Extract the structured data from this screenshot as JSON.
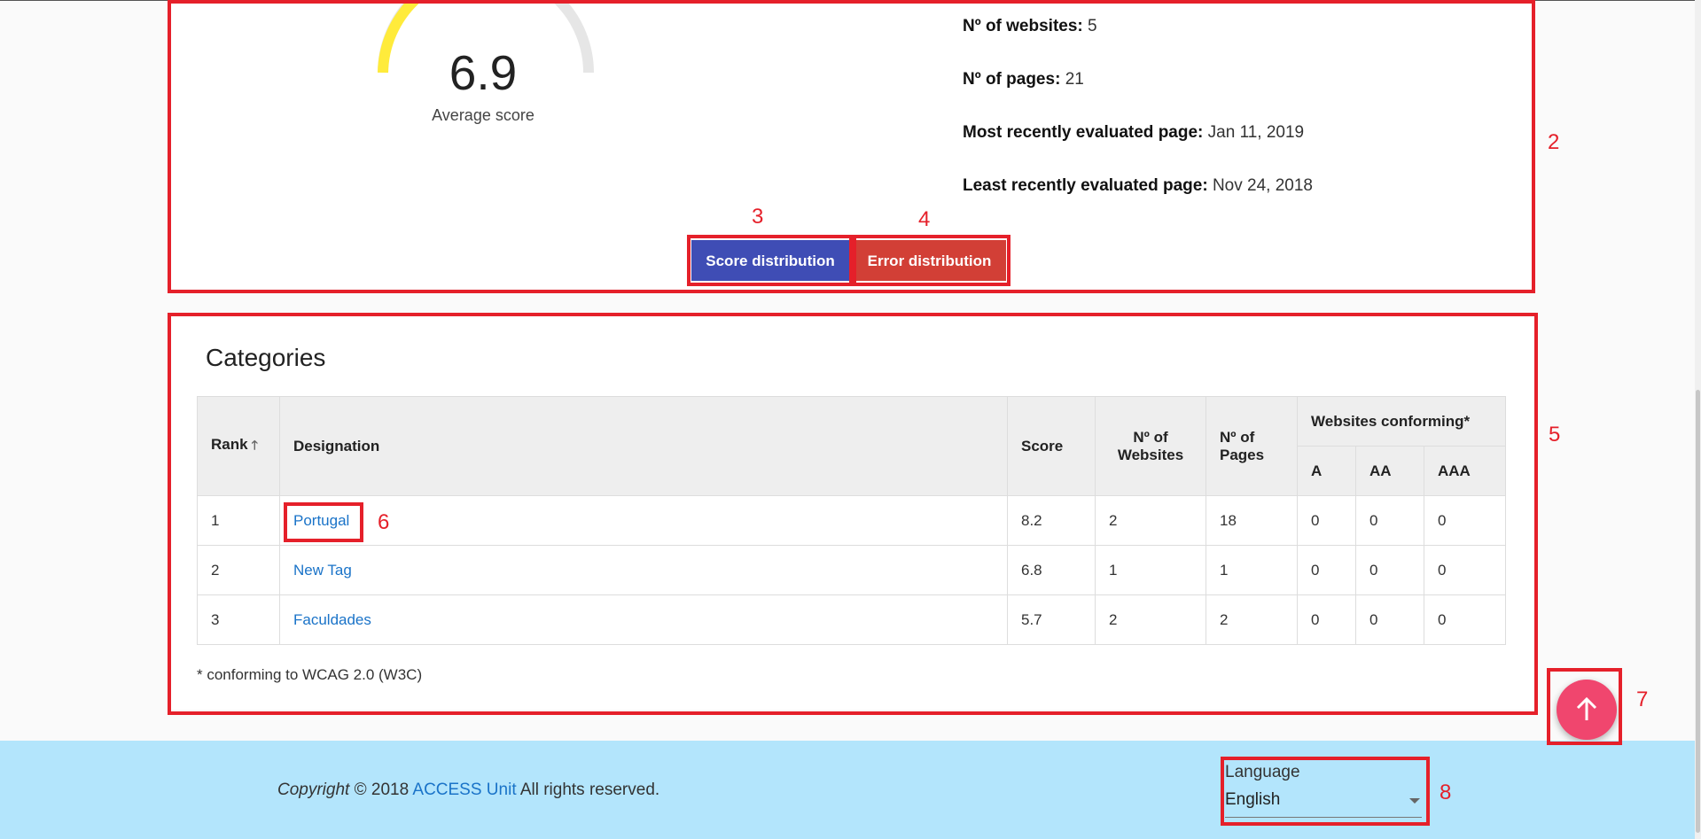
{
  "summary": {
    "average_score": "6.9",
    "average_score_label": "Average score",
    "gauge_level": 0.69,
    "stats": [
      {
        "label": "Nº of websites:",
        "value": "5"
      },
      {
        "label": "Nº of pages:",
        "value": "21"
      },
      {
        "label": "Most recently evaluated page:",
        "value": "Jan 11, 2019"
      },
      {
        "label": "Least recently evaluated page:",
        "value": "Nov 24, 2018"
      }
    ],
    "buttons": {
      "score_distribution": "Score distribution",
      "error_distribution": "Error distribution"
    }
  },
  "categories": {
    "title": "Categories",
    "headers": {
      "rank": "Rank",
      "designation": "Designation",
      "score": "Score",
      "num_websites": "Nº of Websites",
      "num_pages": "Nº of Pages",
      "websites_conforming": "Websites conforming*",
      "a": "A",
      "aa": "AA",
      "aaa": "AAA"
    },
    "rows": [
      {
        "rank": "1",
        "designation": "Portugal",
        "score": "8.2",
        "websites": "2",
        "pages": "18",
        "a": "0",
        "aa": "0",
        "aaa": "0"
      },
      {
        "rank": "2",
        "designation": "New Tag",
        "score": "6.8",
        "websites": "1",
        "pages": "1",
        "a": "0",
        "aa": "0",
        "aaa": "0"
      },
      {
        "rank": "3",
        "designation": "Faculdades",
        "score": "5.7",
        "websites": "2",
        "pages": "2",
        "a": "0",
        "aa": "0",
        "aaa": "0"
      }
    ],
    "footnote": "* conforming to WCAG 2.0 (W3C)"
  },
  "footer": {
    "copyright_prefix": "Copyright",
    "copyright_year": "© 2018",
    "org_link": "ACCESS Unit",
    "rights": "All rights reserved.",
    "language_label": "Language",
    "language_value": "English"
  },
  "annotations": [
    "2",
    "3",
    "4",
    "5",
    "6",
    "7",
    "8"
  ],
  "colors": {
    "score_button": "#3f4db5",
    "error_button": "#d23f36",
    "fab": "#f0466e",
    "footer_bg": "#b3e5fc",
    "link": "#1a73c8",
    "annotation": "#e5202a",
    "gauge_fill": "#ffeb3b"
  },
  "icons": {
    "fab": "arrow-up-icon",
    "sort": "sort-ascending-icon",
    "dropdown": "chevron-down-icon"
  }
}
